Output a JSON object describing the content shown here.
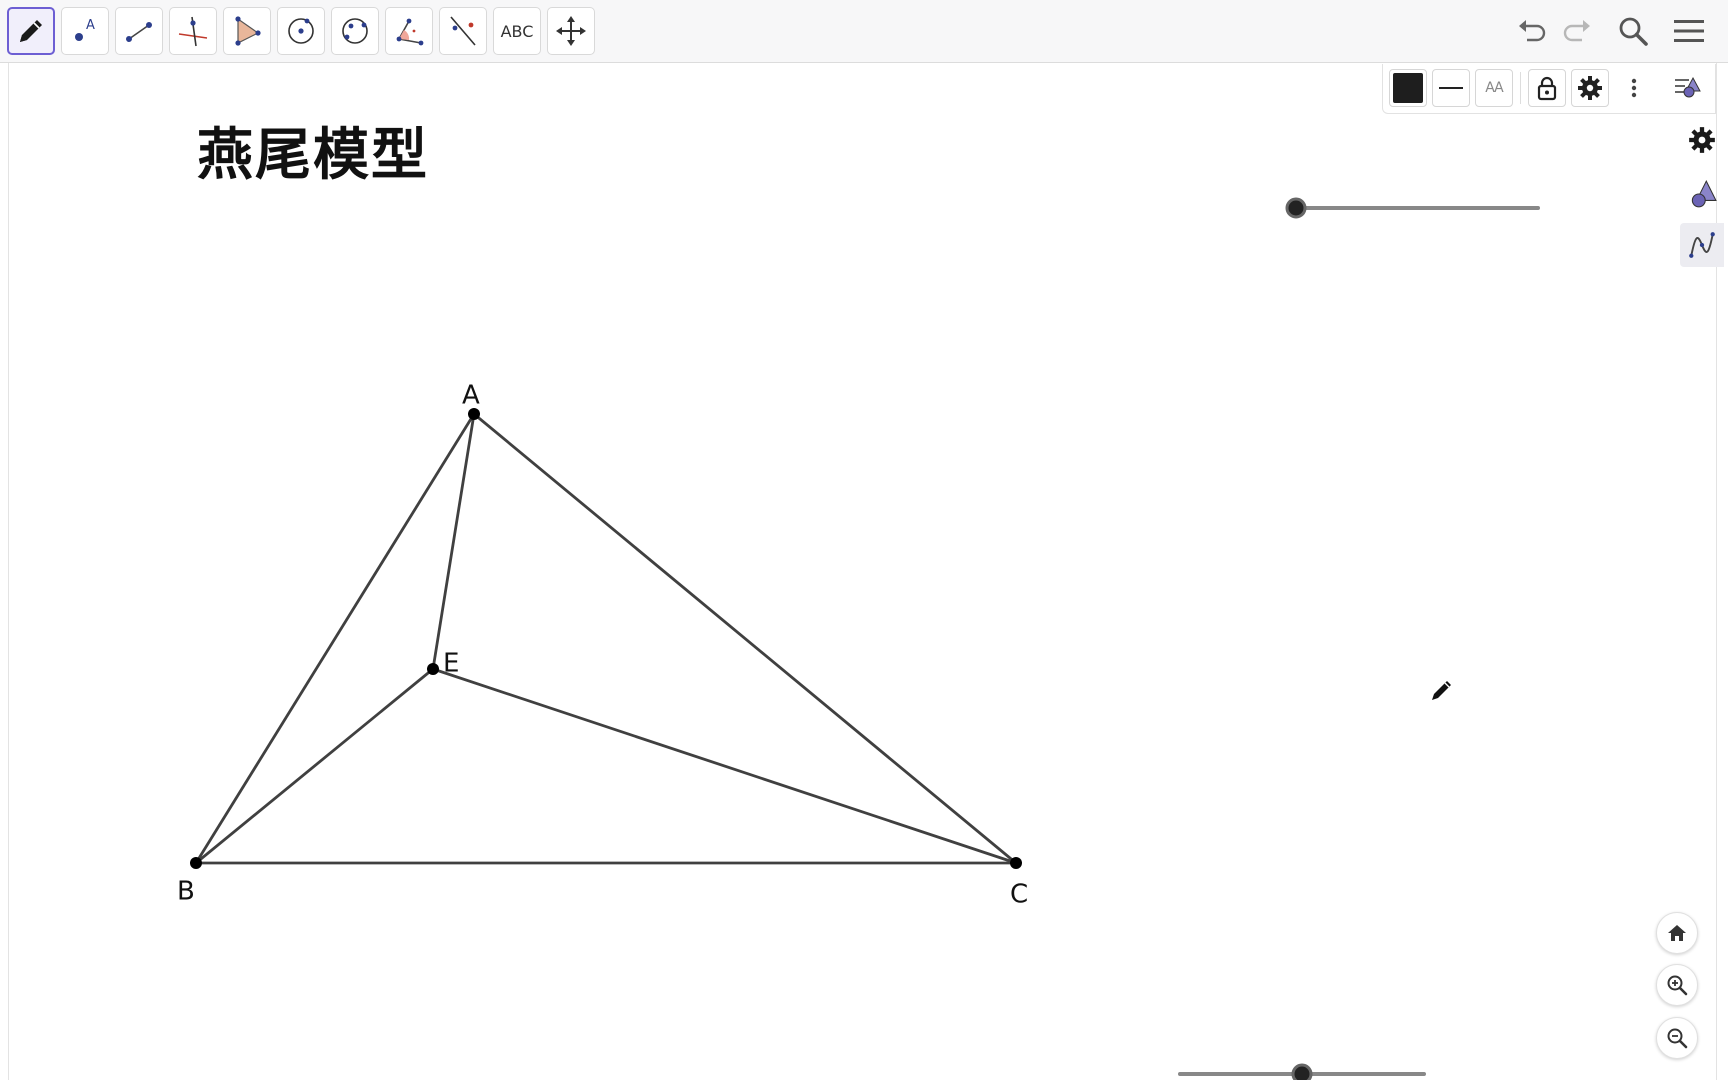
{
  "app": {
    "title": "燕尾模型"
  },
  "toolbar": {
    "tools": [
      {
        "name": "pen-tool",
        "icon": "pen-icon",
        "selected": true
      },
      {
        "name": "point-tool",
        "icon": "point-icon",
        "label": "A"
      },
      {
        "name": "segment-tool",
        "icon": "segment-icon"
      },
      {
        "name": "perpendicular-line-tool",
        "icon": "perpendicular-icon"
      },
      {
        "name": "polygon-tool",
        "icon": "polygon-icon"
      },
      {
        "name": "circle-center-point-tool",
        "icon": "circle-icon"
      },
      {
        "name": "circle-three-points-tool",
        "icon": "circle-three-points-icon"
      },
      {
        "name": "angle-tool",
        "icon": "angle-icon"
      },
      {
        "name": "reflect-line-tool",
        "icon": "reflect-icon"
      },
      {
        "name": "text-tool",
        "label": "ABC"
      },
      {
        "name": "move-graphics-tool",
        "icon": "move-icon"
      }
    ],
    "undo": "undo-icon",
    "redo": "redo-icon",
    "search": "search-icon",
    "menu": "menu-icon"
  },
  "stylebar": {
    "color": "#1e1e1e",
    "line_style": "line-style-icon",
    "text_size_label": "AA",
    "lock": "lock-icon",
    "settings": "gear-icon",
    "more": "more-vertical-icon",
    "toggle_views": "view-toggle-icon"
  },
  "side_panel": {
    "items": [
      "gear-icon",
      "geometry-view-icon",
      "graphing-view-icon"
    ],
    "active": "graphing-view-icon"
  },
  "geometry": {
    "points": [
      {
        "label": "A"
      },
      {
        "label": "B"
      },
      {
        "label": "C"
      },
      {
        "label": "E"
      }
    ],
    "segments": [
      "AB",
      "AC",
      "BC",
      "AE",
      "BE",
      "CE"
    ],
    "stroke_color": "#404040",
    "point_color": "#000000"
  },
  "sliders": {
    "top_slider": {
      "value_fraction": 0.0
    },
    "bottom_slider": {
      "value_fraction": 0.5
    }
  },
  "zoom_controls": [
    "home-icon",
    "zoom-in-icon",
    "zoom-out-icon"
  ],
  "colors": {
    "accent": "#6d5fd3",
    "toolbar_bg": "#f7f7f8",
    "slider_track": "#888888"
  }
}
